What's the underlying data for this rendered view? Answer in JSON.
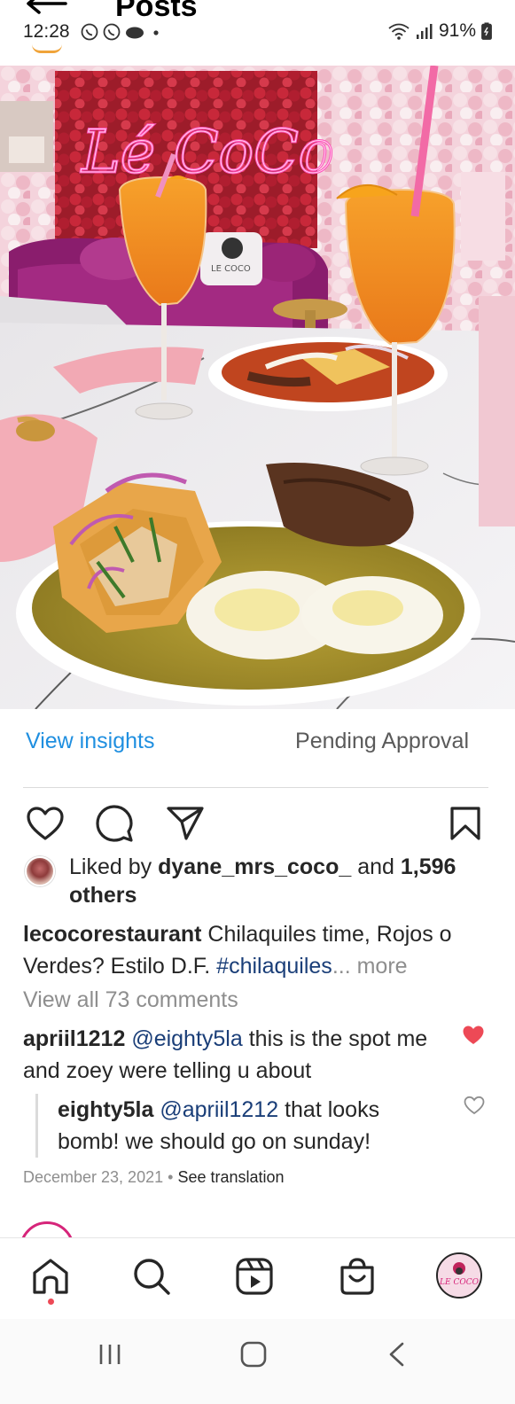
{
  "header": {
    "title": "Posts"
  },
  "status_bar": {
    "time": "12:28",
    "battery": "91%",
    "notification_icons": [
      "whatsapp-icon",
      "whatsapp-icon",
      "cloud-icon",
      "dot-icon"
    ]
  },
  "post": {
    "photo_neon_sign": "Lé CoCo",
    "insights_label": "View insights",
    "approval_status": "Pending Approval",
    "likes": {
      "prefix": "Liked by",
      "user": "dyane_mrs_coco_",
      "and": "and",
      "count": "1,596",
      "suffix": "others"
    },
    "caption": {
      "username": "lecocorestaurant",
      "text": "Chilaquiles time, Rojos o Verdes? Estilo D.F.",
      "hashtag": "#chilaquiles",
      "more": "... more"
    },
    "view_comments": "View all 73 comments",
    "comments": [
      {
        "username": "apriil1212",
        "mention": "@eighty5la",
        "text": "this is the spot me and zoey were telling u about",
        "liked": true
      },
      {
        "username": "eighty5la",
        "mention": "@apriil1212",
        "text": "that looks bomb! we should go on sunday!",
        "liked": false
      }
    ],
    "date": "December 23, 2021",
    "separator": "•",
    "see_translation": "See translation"
  },
  "bottom_nav": {
    "items": [
      "home-icon",
      "search-icon",
      "reels-icon",
      "shop-icon",
      "profile-avatar"
    ],
    "profile_label": "LE COCO"
  },
  "colors": {
    "link_blue": "#1f8fe0",
    "hashtag_blue": "#1a3e78",
    "like_red": "#ed4956",
    "muted": "#8e8e8e"
  }
}
